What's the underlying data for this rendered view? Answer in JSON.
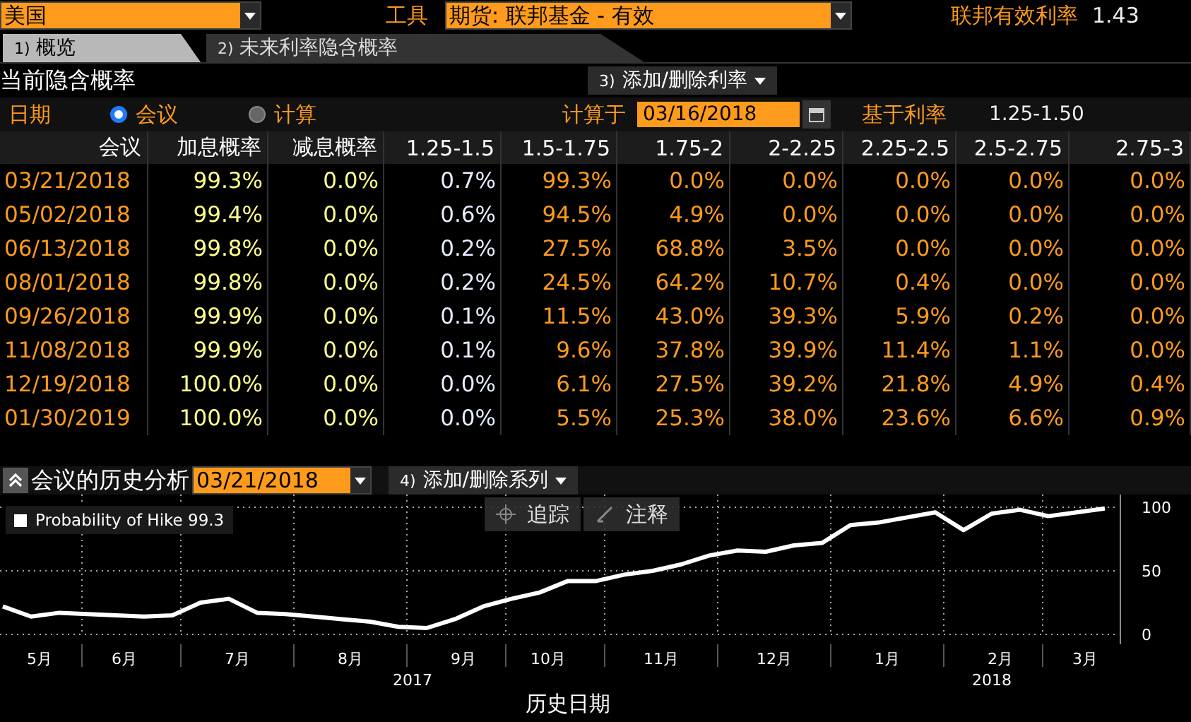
{
  "top_bar": {
    "country": "美国",
    "instrument_label": "工具",
    "instrument": "期货: 联邦基金 - 有效",
    "rate_label": "联邦有效利率",
    "rate_value": "1.43"
  },
  "tabs": [
    {
      "number": "1)",
      "label": "概览",
      "selected": true
    },
    {
      "number": "2)",
      "label": "未来利率隐含概率",
      "selected": false
    }
  ],
  "section": {
    "title": "当前隐含概率",
    "button": {
      "number": "3)",
      "label": "添加/删除利率"
    }
  },
  "date_mode": {
    "label": "日期",
    "options": [
      {
        "label": "会议",
        "selected": true
      },
      {
        "label": "计算",
        "selected": false
      }
    ],
    "calc_label": "计算于",
    "calc_date": "03/16/2018",
    "base_label": "基于利率",
    "base_value": "1.25-1.50"
  },
  "table": {
    "columns": [
      {
        "label": "会议",
        "kind": "date"
      },
      {
        "label": "加息概率",
        "kind": "probability"
      },
      {
        "label": "减息概率",
        "kind": "probability"
      },
      {
        "label": "1.25-1.5",
        "kind": "current"
      },
      {
        "label": "1.5-1.75",
        "kind": "rate"
      },
      {
        "label": "1.75-2",
        "kind": "rate"
      },
      {
        "label": "2-2.25",
        "kind": "rate"
      },
      {
        "label": "2.25-2.5",
        "kind": "rate"
      },
      {
        "label": "2.5-2.75",
        "kind": "rate"
      },
      {
        "label": "2.75-3",
        "kind": "rate"
      }
    ],
    "rows": [
      [
        "03/21/2018",
        "99.3%",
        "0.0%",
        "0.7%",
        "99.3%",
        "0.0%",
        "0.0%",
        "0.0%",
        "0.0%",
        "0.0%"
      ],
      [
        "05/02/2018",
        "99.4%",
        "0.0%",
        "0.6%",
        "94.5%",
        "4.9%",
        "0.0%",
        "0.0%",
        "0.0%",
        "0.0%"
      ],
      [
        "06/13/2018",
        "99.8%",
        "0.0%",
        "0.2%",
        "27.5%",
        "68.8%",
        "3.5%",
        "0.0%",
        "0.0%",
        "0.0%"
      ],
      [
        "08/01/2018",
        "99.8%",
        "0.0%",
        "0.2%",
        "24.5%",
        "64.2%",
        "10.7%",
        "0.4%",
        "0.0%",
        "0.0%"
      ],
      [
        "09/26/2018",
        "99.9%",
        "0.0%",
        "0.1%",
        "11.5%",
        "43.0%",
        "39.3%",
        "5.9%",
        "0.2%",
        "0.0%"
      ],
      [
        "11/08/2018",
        "99.9%",
        "0.0%",
        "0.1%",
        "9.6%",
        "37.8%",
        "39.9%",
        "11.4%",
        "1.1%",
        "0.0%"
      ],
      [
        "12/19/2018",
        "100.0%",
        "0.0%",
        "0.0%",
        "6.1%",
        "27.5%",
        "39.2%",
        "21.8%",
        "4.9%",
        "0.4%"
      ],
      [
        "01/30/2019",
        "100.0%",
        "0.0%",
        "0.0%",
        "5.5%",
        "25.3%",
        "38.0%",
        "23.6%",
        "6.6%",
        "0.9%"
      ]
    ]
  },
  "history": {
    "title": "会议的历史分析",
    "meeting_date": "03/21/2018",
    "button": {
      "number": "4)",
      "label": "添加/删除系列"
    },
    "tools": [
      {
        "label": "追踪",
        "kind": "crosshair"
      },
      {
        "label": "注释",
        "kind": "annotate"
      }
    ],
    "legend_value": "99.3",
    "year_labels": [
      "2017",
      "2018"
    ],
    "chart_data": {
      "type": "line",
      "xlabel": "历史日期",
      "categories": [
        null,
        "5月",
        null,
        null,
        "6月",
        null,
        null,
        null,
        "7月",
        null,
        null,
        null,
        "8月",
        null,
        null,
        null,
        "9月",
        null,
        null,
        "10月",
        null,
        null,
        null,
        "11月",
        null,
        null,
        null,
        "12月",
        null,
        null,
        null,
        "1月",
        null,
        null,
        null,
        "2月",
        null,
        null,
        "3月",
        null
      ],
      "series": [
        {
          "name": "Probability of Hike",
          "color": "#ffffff",
          "values": [
            22,
            14,
            17,
            16,
            15,
            14,
            15,
            25,
            28,
            17,
            16,
            14,
            12,
            10,
            6,
            5,
            12,
            22,
            28,
            33,
            42,
            42,
            47,
            50,
            55,
            62,
            66,
            65,
            70,
            72,
            86,
            88,
            92,
            96,
            82,
            95,
            98,
            93,
            96,
            99
          ]
        }
      ],
      "ylim": [
        0,
        100
      ],
      "yticks": [
        0,
        50,
        100
      ],
      "grid": true
    }
  }
}
